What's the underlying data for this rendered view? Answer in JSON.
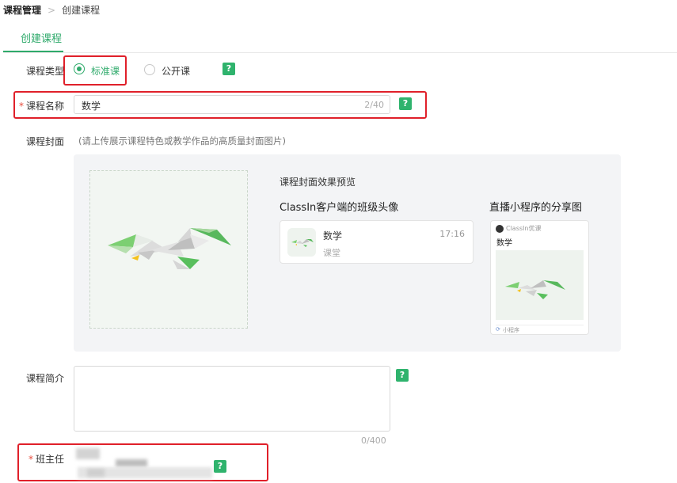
{
  "breadcrumb": {
    "parent": "课程管理",
    "separator": ">",
    "current": "创建课程"
  },
  "tab": {
    "label": "创建课程"
  },
  "course_type": {
    "label": "课程类型",
    "options": [
      {
        "label": "标准课",
        "selected": true
      },
      {
        "label": "公开课",
        "selected": false
      }
    ],
    "help": "?"
  },
  "course_name": {
    "required_mark": "*",
    "label": "课程名称",
    "value": "数学",
    "counter": "2/40",
    "help": "?"
  },
  "cover": {
    "label": "课程封面",
    "hint": "(请上传展示课程特色或教学作品的高质量封面图片)",
    "preview_title": "课程封面效果预览",
    "client_avatar_title": "ClassIn客户端的班级头像",
    "client_card": {
      "name": "数学",
      "time": "17:16",
      "sub": "课堂"
    },
    "share_title": "直播小程序的分享图",
    "share_card": {
      "brand": "ClassIn优课",
      "name": "数学",
      "footer": "小程序"
    }
  },
  "intro": {
    "label": "课程简介",
    "value": "",
    "counter": "0/400",
    "help": "?"
  },
  "head_teacher": {
    "required_mark": "*",
    "label": "班主任",
    "help": "?"
  },
  "colors": {
    "accent": "#2faa6b",
    "highlight": "#e0202a",
    "bird_green": "#5cc060"
  }
}
